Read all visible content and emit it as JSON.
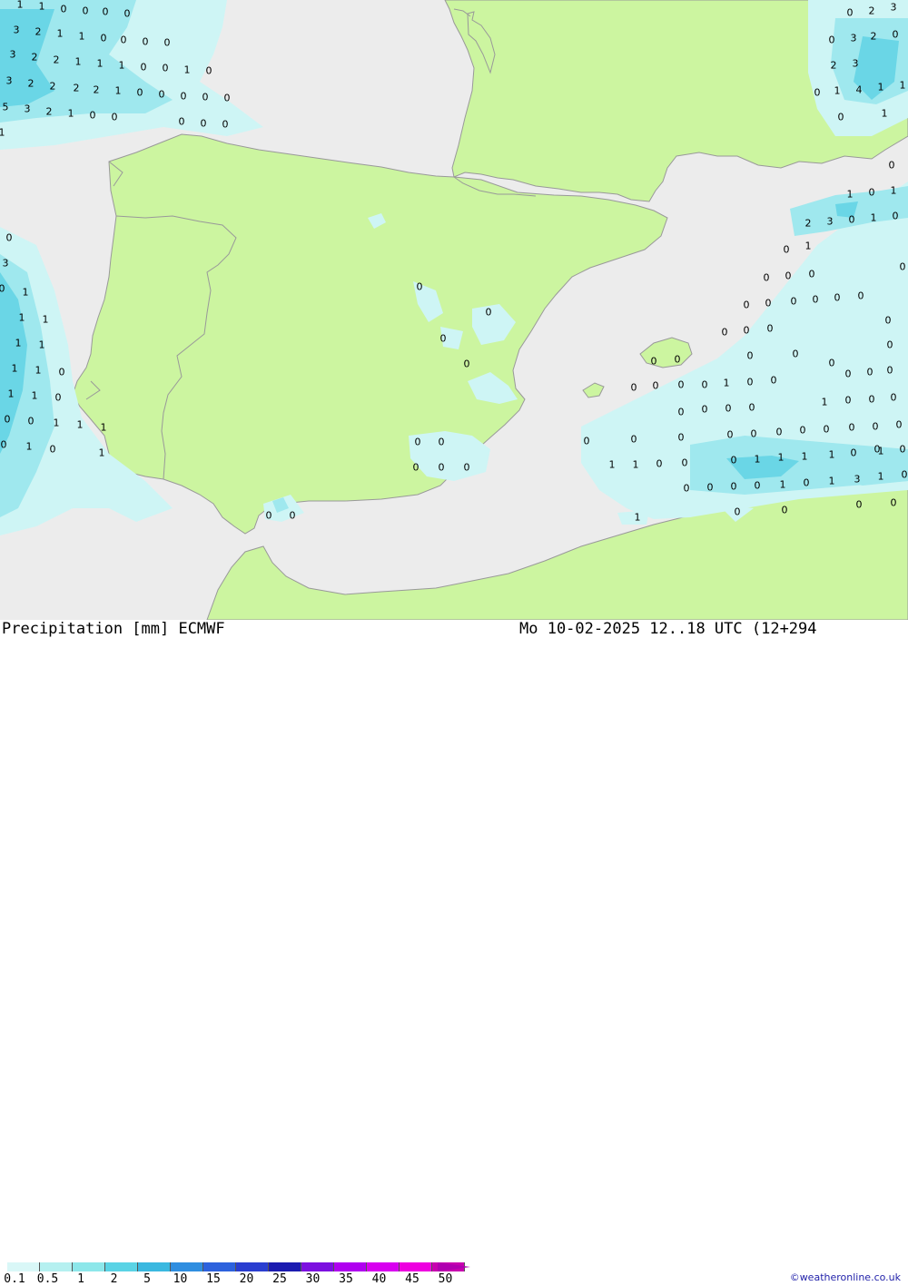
{
  "title": "Precipitation [mm] ECMWF",
  "datetime": "Mo 10-02-2025 12..18 UTC (12+294",
  "credit": "©weatheronline.co.uk",
  "colors": {
    "sea": "#ececec",
    "land": "#ccf5a0",
    "border": "#999999",
    "precip_light": "#cef5f5",
    "precip_mid": "#9fe8ee",
    "precip_heavy": "#6ad6e6"
  },
  "legend": {
    "ticks": [
      "0.1",
      "0.5",
      "1",
      "2",
      "5",
      "10",
      "15",
      "20",
      "25",
      "30",
      "35",
      "40",
      "45",
      "50"
    ],
    "colors": [
      "#d9f7f7",
      "#b5f0f0",
      "#8de7ea",
      "#5ad3e5",
      "#3ab8e0",
      "#2f8ee0",
      "#2d62dd",
      "#2a3ed0",
      "#1b1bb0",
      "#7c10e0",
      "#b000f0",
      "#d800f0",
      "#ee00e0",
      "#c800b0"
    ]
  },
  "map_labels": [
    "1",
    "1",
    "0",
    "0",
    "0",
    "0",
    "3",
    "2",
    "1",
    "1",
    "0",
    "0",
    "0",
    "0",
    "3",
    "2",
    "2",
    "1",
    "1",
    "1",
    "0",
    "0",
    "1",
    "0",
    "3",
    "2",
    "2",
    "2",
    "2",
    "1",
    "0",
    "0",
    "0",
    "0",
    "0",
    "5",
    "3",
    "2",
    "1",
    "0",
    "0",
    "0",
    "0",
    "0",
    "1",
    "0",
    "2",
    "3",
    "0",
    "3",
    "2",
    "0",
    "2",
    "3",
    "0",
    "1",
    "4",
    "1",
    "1",
    "0",
    "1",
    "0",
    "1",
    "0",
    "1",
    "2",
    "3",
    "0",
    "1",
    "0",
    "0",
    "1",
    "0",
    "0",
    "0",
    "0",
    "0",
    "0",
    "0",
    "0",
    "0",
    "0",
    "0",
    "0",
    "0",
    "0",
    "0",
    "0",
    "0",
    "0",
    "0",
    "0",
    "0",
    "0",
    "0",
    "0",
    "0",
    "0",
    "0",
    "1",
    "0",
    "0",
    "1",
    "0",
    "0",
    "0",
    "0",
    "0",
    "0",
    "0",
    "0",
    "0",
    "0",
    "0",
    "0",
    "0",
    "0",
    "0",
    "0",
    "0",
    "0",
    "0",
    "1",
    "1",
    "0",
    "0",
    "0",
    "1",
    "1",
    "1",
    "1",
    "0",
    "1",
    "0",
    "1",
    "0",
    "0",
    "0",
    "0",
    "1",
    "0",
    "1",
    "3",
    "0",
    "1",
    "0",
    "0",
    "0",
    "0",
    "0",
    "0",
    "0",
    "0",
    "0",
    "0",
    "0",
    "0",
    "0",
    "0",
    "0",
    "0",
    "3",
    "0",
    "1",
    "1",
    "1",
    "1",
    "1",
    "1",
    "1",
    "0",
    "1",
    "1",
    "0",
    "0",
    "0",
    "1",
    "1",
    "1",
    "0",
    "1",
    "0",
    "1"
  ]
}
